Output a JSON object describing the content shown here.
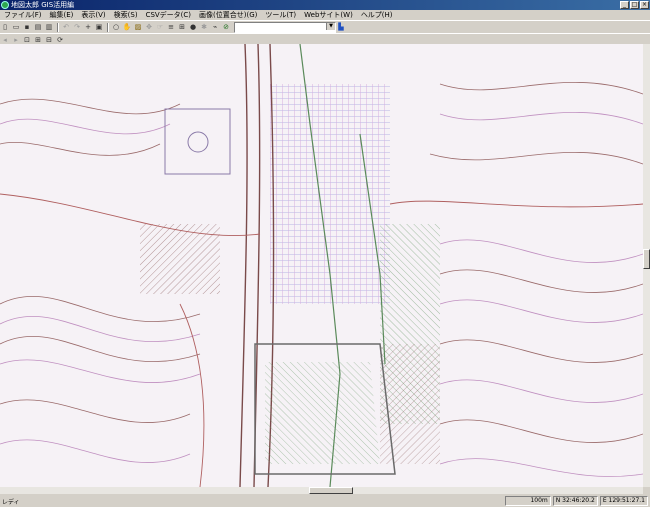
{
  "window": {
    "title": "地図太郎 GIS活用編"
  },
  "menu": [
    "ファイル(F)",
    "編集(E)",
    "表示(V)",
    "検索(S)",
    "CSVデータ(C)",
    "画像(位置合せ)(G)",
    "ツール(T)",
    "Webサイト(W)",
    "ヘルプ(H)"
  ],
  "toolbar1": {
    "icons": [
      "new-icon",
      "open-icon",
      "save-icon",
      "print-preview-icon",
      "print-icon",
      "undo-icon",
      "redo-icon",
      "crosshair-icon",
      "copy-icon",
      "zoom-icon",
      "pan-icon",
      "locate-icon",
      "move-icon",
      "hand-icon",
      "layers-icon",
      "table-icon",
      "marker-icon",
      "bullet-icon",
      "link-icon",
      "no-icon"
    ],
    "combo_value": ""
  },
  "toolbar2": {
    "icons": [
      "back-icon",
      "forward-icon",
      "zoom-window-icon",
      "zoom-in-icon",
      "zoom-out-icon",
      "refresh-icon"
    ]
  },
  "status": {
    "text": "レディ",
    "scale": "100m",
    "lat": "N 32:46:20.2",
    "lon": "E 129:51:27.1"
  },
  "colors": {
    "title_bar": "#0a246a",
    "chrome": "#d4d0c8",
    "map_bg": "#f4f1f4"
  }
}
